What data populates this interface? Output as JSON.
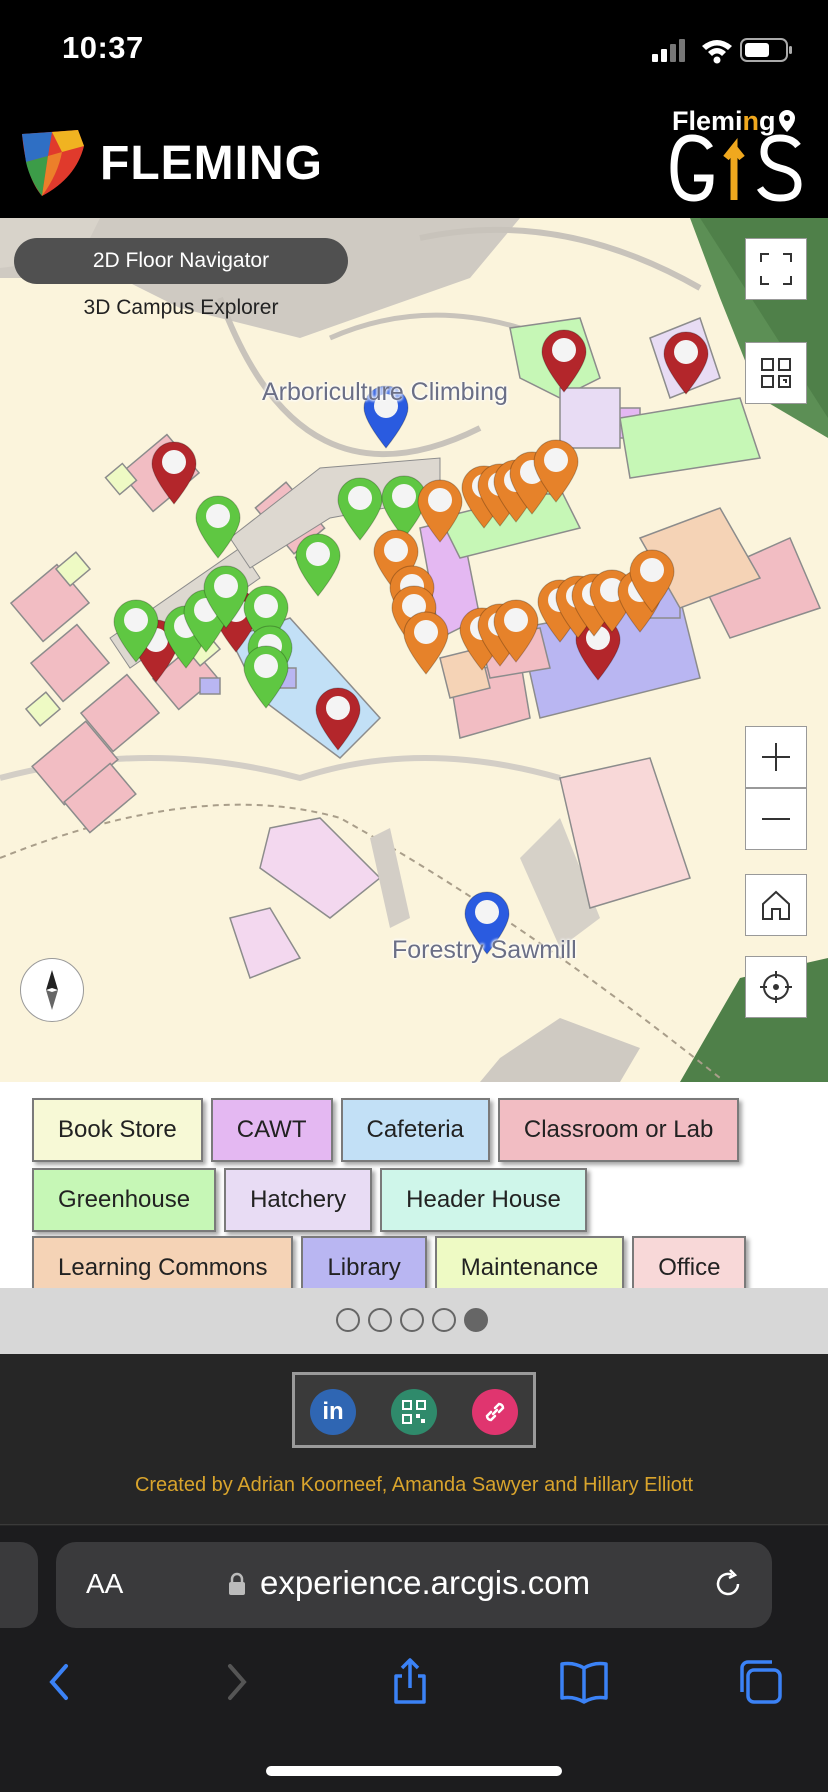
{
  "status_bar": {
    "time": "10:37"
  },
  "header": {
    "brand": "FLEMING",
    "gis_top_a": "Flemi",
    "gis_top_b": "n",
    "gis_top_c": "g"
  },
  "map": {
    "nav_2d": "2D Floor Navigator",
    "nav_3d": "3D Campus Explorer",
    "labels": {
      "arboriculture": "Arboriculture Climbing",
      "sawmill": "Forestry Sawmill"
    },
    "colors": {
      "background": "#fbf4dc",
      "pin_red": "#b3262b",
      "pin_green": "#5fc742",
      "pin_orange": "#e6822a",
      "pin_blue": "#2a5be0"
    },
    "controls": [
      "fullscreen-icon",
      "qr-scan-icon",
      "zoom-in-icon",
      "zoom-out-icon",
      "home-icon",
      "locate-icon",
      "compass-icon"
    ]
  },
  "legend": {
    "items": [
      {
        "label": "Book Store",
        "color": "#f7f9d6"
      },
      {
        "label": "CAWT",
        "color": "#e4b8f2"
      },
      {
        "label": "Cafeteria",
        "color": "#c2e0f6"
      },
      {
        "label": "Classroom or Lab",
        "color": "#f2bdc3"
      },
      {
        "label": "Greenhouse",
        "color": "#c6f7b6"
      },
      {
        "label": "Hatchery",
        "color": "#e8dcf4"
      },
      {
        "label": "Header House",
        "color": "#cff6ea"
      },
      {
        "label": "Learning Commons",
        "color": "#f5d3b6"
      },
      {
        "label": "Library",
        "color": "#b9b6f2"
      },
      {
        "label": "Maintenance",
        "color": "#eefac4"
      },
      {
        "label": "Office",
        "color": "#f8d8d8"
      }
    ]
  },
  "pager": {
    "pages": 5,
    "active": 5
  },
  "footer": {
    "share": [
      "linkedin-icon",
      "qr-code-icon",
      "link-icon"
    ],
    "linkedin_text": "in",
    "credits": "Created by Adrian Koorneef, Amanda Sawyer and Hillary Elliott"
  },
  "browser": {
    "aa": "AA",
    "url": "experience.arcgis.com"
  }
}
